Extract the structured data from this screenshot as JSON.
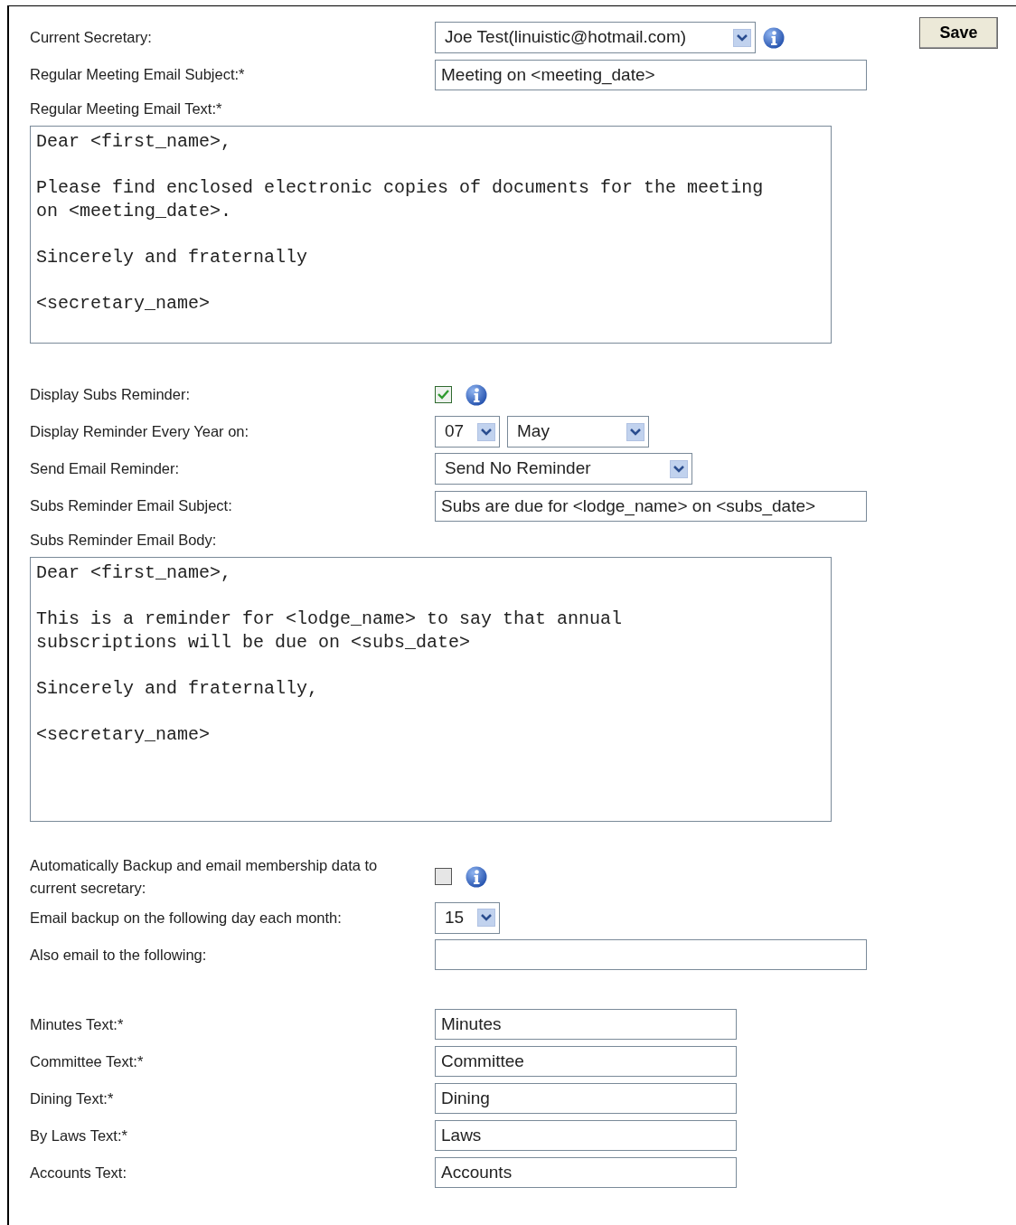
{
  "save_button": "Save",
  "sections": [
    {
      "rows": [
        {
          "kind": "select",
          "label": "Current Secretary:",
          "values": [
            "Joe Test(linuistic@hotmail.com)"
          ],
          "info": true
        },
        {
          "kind": "text",
          "label": "Regular Meeting Email Subject:*",
          "value": "Meeting on <meeting_date>"
        },
        {
          "kind": "textarea",
          "label": "Regular Meeting Email Text:*",
          "value": "Dear <first_name>,\n\nPlease find enclosed electronic copies of documents for the meeting\non <meeting_date>.\n\nSincerely and fraternally\n\n<secretary_name>"
        }
      ]
    },
    {
      "rows": [
        {
          "kind": "checkbox",
          "label": "Display Subs Reminder:",
          "checked": true,
          "info": true
        },
        {
          "kind": "date",
          "label": "Display Reminder Every Year on:",
          "values": [
            "07",
            "May"
          ]
        },
        {
          "kind": "select",
          "label": "Send Email Reminder:",
          "values": [
            "Send No Reminder"
          ]
        },
        {
          "kind": "text",
          "label": "Subs Reminder Email Subject:",
          "value": "Subs are due for <lodge_name> on <subs_date>"
        },
        {
          "kind": "textarea",
          "label": "Subs Reminder Email Body:",
          "value": "Dear <first_name>,\n\nThis is a reminder for <lodge_name> to say that annual\nsubscriptions will be due on <subs_date>\n\nSincerely and fraternally,\n\n<secretary_name>"
        }
      ]
    },
    {
      "rows": [
        {
          "kind": "checkbox",
          "label": "Automatically Backup and email membership data to current secretary:",
          "checked": false,
          "info": true
        },
        {
          "kind": "day",
          "label": "Email backup on the following day each month:",
          "values": [
            "15"
          ]
        },
        {
          "kind": "text",
          "label": "Also email to the following:",
          "value": ""
        }
      ]
    },
    {
      "rows": [
        {
          "kind": "short-text",
          "label": "Minutes Text:*",
          "value": "Minutes"
        },
        {
          "kind": "short-text",
          "label": "Committee Text:*",
          "value": "Committee"
        },
        {
          "kind": "short-text",
          "label": "Dining Text:*",
          "value": "Dining"
        },
        {
          "kind": "short-text",
          "label": "By Laws Text:*",
          "value": "Laws"
        },
        {
          "kind": "short-text",
          "label": "Accounts Text:",
          "value": "Accounts"
        }
      ]
    }
  ]
}
